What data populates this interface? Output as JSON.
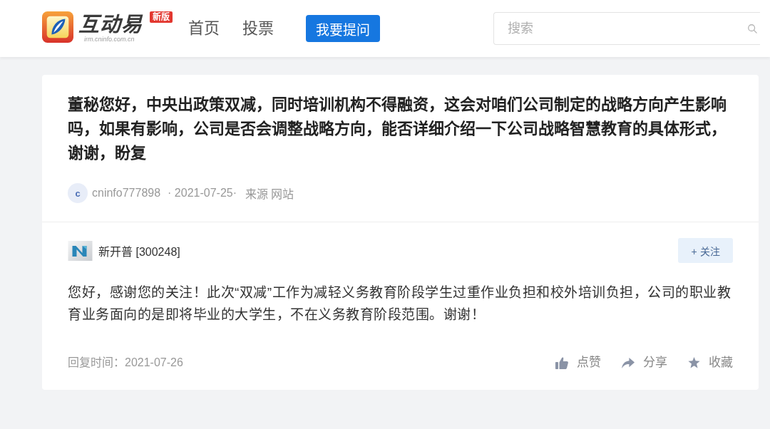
{
  "header": {
    "logo": {
      "name": "互动易",
      "badge": "新版",
      "domain": "irm.cninfo.com.cn"
    },
    "nav": [
      {
        "label": "首页",
        "selected": false
      },
      {
        "label": "投票",
        "selected": false
      }
    ],
    "ask_button": "我要提问",
    "search": {
      "placeholder": "搜索"
    }
  },
  "question": {
    "text": "董秘您好，中央出政策双减，同时培训机构不得融资，这会对咱们公司制定的战略方向产生影响吗，如果有影响，公司是否会调整战略方向，能否详细介绍一下公司战略智慧教育的具体形式，谢谢，盼复",
    "author": {
      "avatar_letter": "c",
      "name": "cninfo777898"
    },
    "date": "· 2021-07-25·",
    "source": "来源 网站"
  },
  "answer": {
    "company": "新开普 [300248]",
    "follow_button": "+ 关注",
    "text": "您好，感谢您的关注！此次“双减”工作为减轻义务教育阶段学生过重作业负担和校外培训负担，公司的职业教育业务面向的是即将毕业的大学生，不在义务教育阶段范围。谢谢！",
    "reply_time": "回复时间：2021-07-26",
    "actions": [
      {
        "kind": "like",
        "label": "点赞"
      },
      {
        "kind": "share",
        "label": "分享"
      },
      {
        "kind": "favorite",
        "label": "收藏"
      }
    ]
  }
}
